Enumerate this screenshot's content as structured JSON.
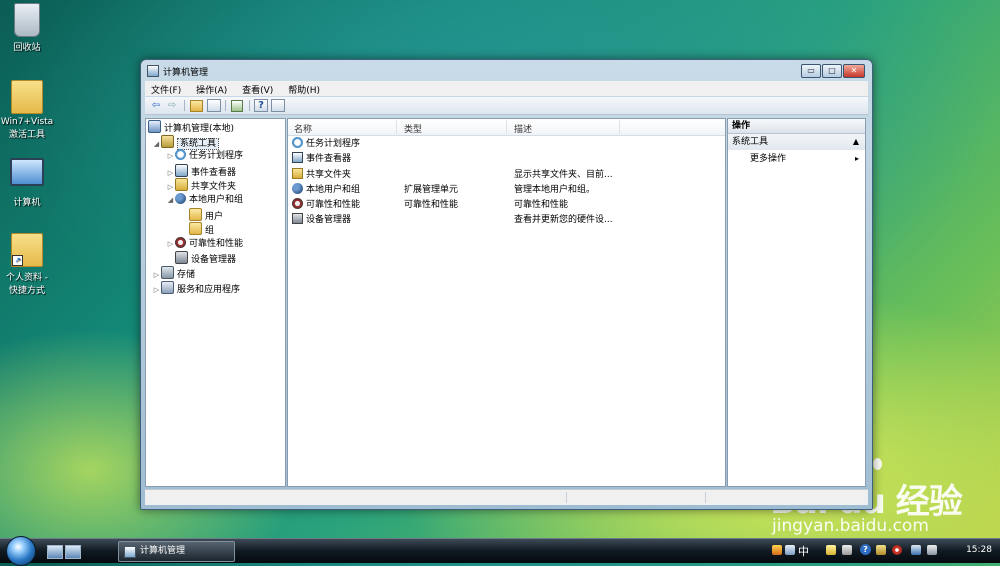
{
  "desktop": {
    "icons": [
      {
        "label_line1": "回收站",
        "label_line2": "",
        "icon": "recycle-bin-icon"
      },
      {
        "label_line1": "Win7+Vista",
        "label_line2": "激活工具",
        "icon": "folder-icon"
      },
      {
        "label_line1": "计算机",
        "label_line2": "",
        "icon": "computer-icon"
      },
      {
        "label_line1": "个人资料 -",
        "label_line2": "快捷方式",
        "icon": "folder-shortcut-icon"
      }
    ]
  },
  "window": {
    "title": "计算机管理",
    "controls": {
      "minimize": "▭",
      "maximize": "□",
      "close": "✕"
    },
    "menu": [
      "文件(F)",
      "操作(A)",
      "查看(V)",
      "帮助(H)"
    ],
    "toolbar": {
      "back": "⇦",
      "forward": "⇨",
      "help": "?"
    },
    "tree": {
      "root": "计算机管理(本地)",
      "nodes": [
        {
          "label": "系统工具",
          "expander": "◢",
          "icon": "tools-icon"
        },
        {
          "label": "任务计划程序",
          "expander": "▷",
          "icon": "clock-icon"
        },
        {
          "label": "事件查看器",
          "expander": "▷",
          "icon": "event-viewer-icon"
        },
        {
          "label": "共享文件夹",
          "expander": "▷",
          "icon": "shared-folder-icon"
        },
        {
          "label": "本地用户和组",
          "expander": "◢",
          "icon": "users-icon"
        },
        {
          "label": "用户",
          "expander": "",
          "icon": "folder-icon"
        },
        {
          "label": "组",
          "expander": "",
          "icon": "folder-icon"
        },
        {
          "label": "可靠性和性能",
          "expander": "▷",
          "icon": "performance-icon"
        },
        {
          "label": "设备管理器",
          "expander": "",
          "icon": "device-manager-icon"
        },
        {
          "label": "存储",
          "expander": "▷",
          "icon": "storage-icon"
        },
        {
          "label": "服务和应用程序",
          "expander": "▷",
          "icon": "services-icon"
        }
      ]
    },
    "list": {
      "headers": [
        "名称",
        "类型",
        "描述"
      ],
      "rows": [
        {
          "name": "任务计划程序",
          "type": "",
          "desc": "",
          "icon": "clock-icon"
        },
        {
          "name": "事件查看器",
          "type": "",
          "desc": "",
          "icon": "event-viewer-icon"
        },
        {
          "name": "共享文件夹",
          "type": "",
          "desc": "显示共享文件夹、目前...",
          "icon": "shared-folder-icon"
        },
        {
          "name": "本地用户和组",
          "type": "扩展管理单元",
          "desc": "管理本地用户和组。",
          "icon": "users-icon"
        },
        {
          "name": "可靠性和性能",
          "type": "可靠性和性能",
          "desc": "可靠性和性能",
          "icon": "performance-icon"
        },
        {
          "name": "设备管理器",
          "type": "",
          "desc": "查看并更新您的硬件设...",
          "icon": "device-manager-icon"
        }
      ]
    },
    "actions": {
      "header": "操作",
      "section": "系统工具",
      "section_arrow": "▲",
      "more": "更多操作",
      "more_arrow": "▸"
    }
  },
  "taskbar": {
    "task_button": "计算机管理",
    "ime": "中",
    "clock": "15:28"
  },
  "watermark": {
    "brand": "Bai du 经验",
    "url": "jingyan.baidu.com"
  },
  "colors": {
    "accent": "#2d6cc0",
    "close_button": "#c6372a"
  }
}
